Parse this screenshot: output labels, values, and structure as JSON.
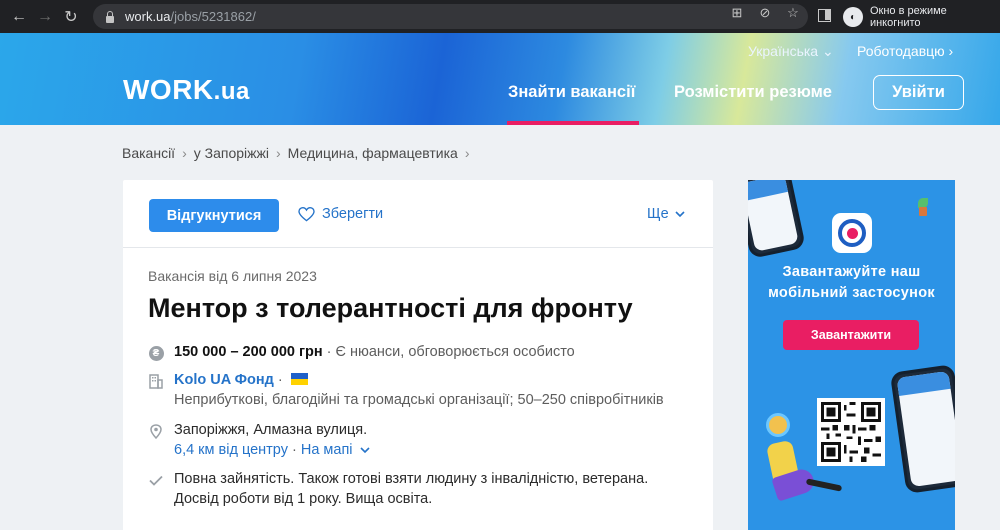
{
  "browser": {
    "url_host": "work.ua",
    "url_path": "/jobs/5231862/",
    "incognito_label": "Окно в режиме инкогнито"
  },
  "header": {
    "logo_main": "WORK",
    "logo_suffix": ".ua",
    "language": "Українська ⌄",
    "employer_link": "Роботодавцю ›",
    "nav_find": "Знайти вакансії",
    "nav_post": "Розмістити резюме",
    "login": "Увійти"
  },
  "breadcrumb": {
    "items": [
      "Вакансії",
      "у Запоріжжі",
      "Медицина, фармацевтика"
    ],
    "separator": "›"
  },
  "toolbar": {
    "apply": "Відгукнутися",
    "save": "Зберегти",
    "more": "Ще"
  },
  "job": {
    "posted": "Вакансія від 6 липня 2023",
    "title": "Ментор з толерантності для фронту",
    "salary": "150 000 – 200 000 грн",
    "salary_note": " · Є нюанси, обговорюється особисто",
    "company": "Kolo UA Фонд",
    "company_sep": " · ",
    "company_desc": "Неприбуткові, благодійні та громадські організації; 50–250 співробітників",
    "location": "Запоріжжя, Алмазна вулиця.",
    "distance": "6,4 км від центру",
    "distance_sep": " · ",
    "map_link": "На мапі",
    "conditions": "Повна зайнятість. Також готові взяти людину з інвалідністю, ветерана.",
    "experience": "Досвід роботи від 1 року. Вища освіта."
  },
  "ad": {
    "headline_line1": "Завантажуйте наш",
    "headline_line2": "мобільний застосунок",
    "button": "Завантажити"
  },
  "colors": {
    "accent_blue": "#2d8ceb",
    "link_blue": "#2573c9",
    "brand_pink": "#e91e63"
  }
}
